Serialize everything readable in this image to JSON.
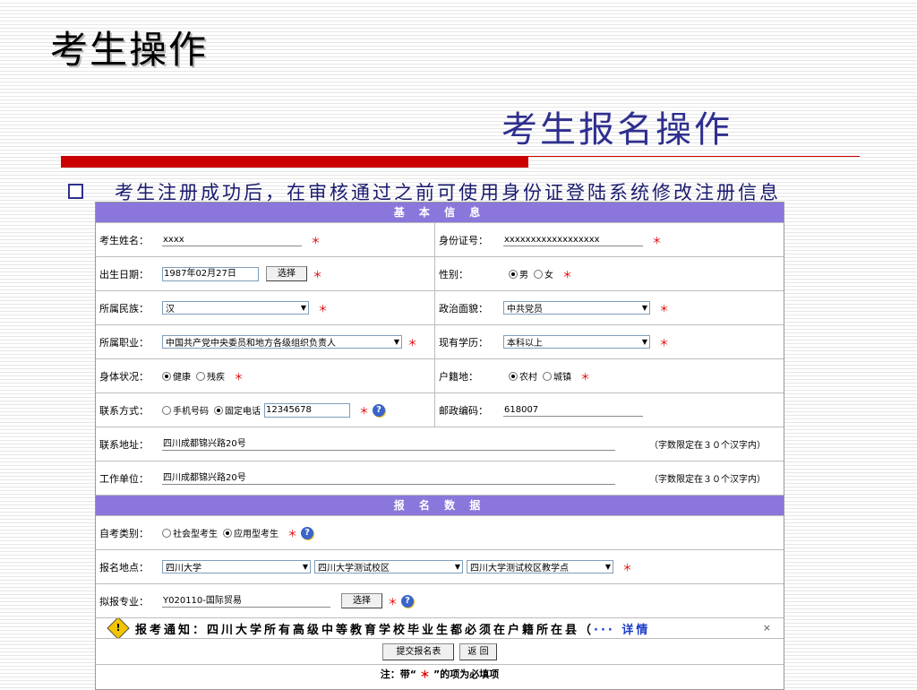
{
  "slide": {
    "title": "考生操作",
    "subtitle": "考生报名操作",
    "bullet": "考生注册成功后，在审核通过之前可使用身份证登陆系统修改注册信息"
  },
  "colors": {
    "section_header": "#8b77dc",
    "accent_bar": "#cc0000",
    "required": "#e00000",
    "subtitle": "#2f2f8f"
  },
  "form": {
    "basic_header": "基 本 信 息",
    "name_label": "考生姓名：",
    "name_value": "xxxx",
    "id_label": "身份证号：",
    "id_value": "xxxxxxxxxxxxxxxxxx",
    "birth_label": "出生日期：",
    "birth_value": "1987年02月27日",
    "choose_btn": "选择",
    "gender_label": "性别：",
    "gender_male": "男",
    "gender_female": "女",
    "ethnic_label": "所属民族：",
    "ethnic_value": "汉",
    "political_label": "政治面貌：",
    "political_value": "中共党员",
    "job_label": "所属职业：",
    "job_value": "中国共产党中央委员和地方各级组织负责人",
    "edu_label": "现有学历：",
    "edu_value": "本科以上",
    "health_label": "身体状况：",
    "health_ok": "健康",
    "health_dis": "残疾",
    "hukou_label": "户籍地：",
    "hukou_rural": "农村",
    "hukou_urban": "城镇",
    "contact_label": "联系方式：",
    "contact_mobile": "手机号码",
    "contact_fixed": "固定电话",
    "contact_value": "12345678",
    "zip_label": "邮政编码：",
    "zip_value": "618007",
    "address_label": "联系地址：",
    "address_value": "四川成都锦兴路20号",
    "limit_note": "（字数限定在３０个汉字内）",
    "work_label": "工作单位：",
    "work_value": "四川成都锦兴路20号",
    "apply_header": "报 名 数 据",
    "category_label": "自考类别：",
    "category_social": "社会型考生",
    "category_applied": "应用型考生",
    "location_label": "报名地点：",
    "location_1": "四川大学",
    "location_2": "四川大学测试校区",
    "location_3": "四川大学测试校区教学点",
    "major_label": "拟报专业：",
    "major_value": "Y020110-国际贸易",
    "notice_text": "报考通知：四川大学所有高级中等教育学校毕业生都必须在户籍所在县（",
    "notice_more": "··· 详情",
    "close_mark": "×",
    "submit_btn": "提交报名表",
    "back_btn": "返 回",
    "req_note_prefix": "注：带“",
    "req_note_star": "＊",
    "req_note_suffix": "”的项为必填项",
    "star": "＊",
    "help": "?"
  }
}
